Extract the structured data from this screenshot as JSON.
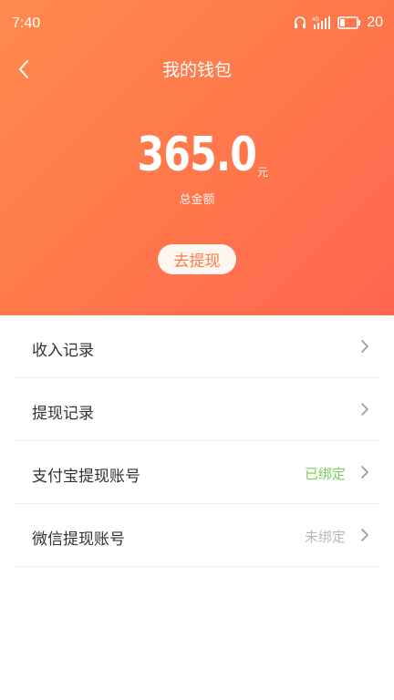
{
  "status_bar": {
    "time": "7:40",
    "battery_level": "20",
    "icons": [
      "headset-icon",
      "signal-icon",
      "battery-icon"
    ]
  },
  "header": {
    "title": "我的钱包",
    "back_icon": "chevron-left-icon",
    "gradient_colors": [
      "#ff8a4e",
      "#ff6650"
    ]
  },
  "wallet": {
    "amount": "365.0",
    "unit": "元",
    "total_label": "总金额",
    "withdraw_button": "去提现"
  },
  "menu": {
    "items": [
      {
        "label": "收入记录",
        "status": "",
        "icon": "chevron-right-icon"
      },
      {
        "label": "提现记录",
        "status": "",
        "icon": "chevron-right-icon"
      },
      {
        "label": "支付宝提现账号",
        "status": "已绑定",
        "status_color": "#7ccf5a",
        "icon": "chevron-right-icon"
      },
      {
        "label": "微信提现账号",
        "status": "未绑定",
        "status_color": "#b8b8b8",
        "icon": "chevron-right-icon"
      }
    ]
  }
}
